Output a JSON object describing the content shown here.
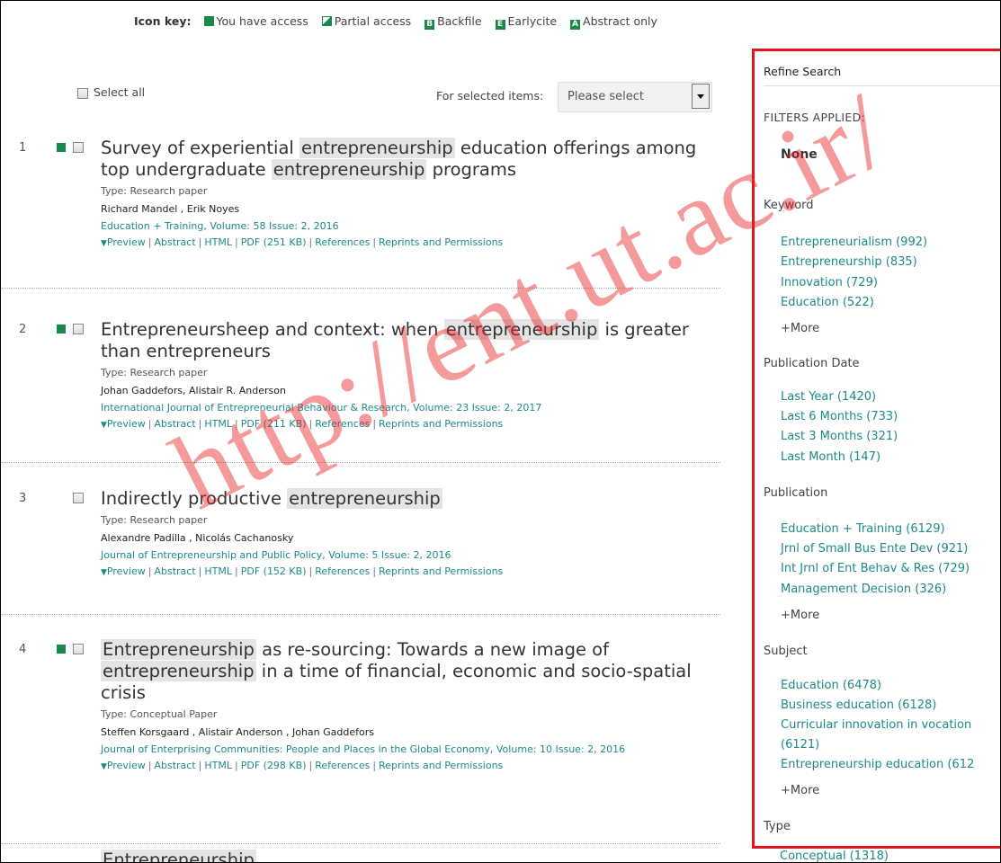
{
  "icon_key": {
    "label": "Icon key:",
    "items": [
      "You have access",
      "Partial access",
      "Backfile",
      "Earlycite",
      "Abstract only"
    ],
    "letters": [
      "B",
      "E",
      "A"
    ],
    "color": "#1a8a4a"
  },
  "toolbar": {
    "select_all": "Select all",
    "for_selected": "For selected items:",
    "dropdown_value": "Please select"
  },
  "results": [
    {
      "number": "1",
      "title_parts": [
        "Survey of experiential ",
        "entrepreneurship",
        " education offerings among top undergraduate ",
        "entrepreneurship",
        " programs"
      ],
      "type": "Type: Research paper",
      "authors": "Richard Mandel , Erik Noyes",
      "journal": "Education + Training, Volume: 58 Issue: 2, 2016",
      "links": [
        "Preview",
        "Abstract",
        "HTML",
        "PDF (251 KB)",
        "References",
        "Reprints and Permissions"
      ]
    },
    {
      "number": "2",
      "title_parts": [
        "Entrepreneursheep and context: when ",
        "entrepreneurship",
        " is greater than entrepreneurs"
      ],
      "type": "Type: Research paper",
      "authors": "Johan Gaddefors, Alistair R. Anderson",
      "journal": "International Journal of Entrepreneurial Behaviour & Research, Volume: 23 Issue: 2, 2017",
      "links": [
        "Preview",
        "Abstract",
        "HTML",
        "PDF (211 KB)",
        "References",
        "Reprints and Permissions"
      ]
    },
    {
      "number": "3",
      "title_parts": [
        "Indirectly productive ",
        "entrepreneurship",
        ""
      ],
      "type": "Type: Research paper",
      "authors": "Alexandre Padilla , Nicolás Cachanosky",
      "journal": "Journal of Entrepreneurship and Public Policy, Volume: 5 Issue: 2, 2016",
      "links": [
        "Preview",
        "Abstract",
        "HTML",
        "PDF (152 KB)",
        "References",
        "Reprints and Permissions"
      ]
    },
    {
      "number": "4",
      "title_parts": [
        "",
        "Entrepreneurship",
        " as re-sourcing: Towards a new image of ",
        "entrepreneurship",
        " in a time of financial, economic and socio-spatial crisis"
      ],
      "type": "Type: Conceptual Paper",
      "authors": "Steffen Korsgaard , Alistair Anderson , Johan Gaddefors",
      "journal": "Journal of Enterprising Communities: People and Places in the Global Economy, Volume: 10 Issue: 2, 2016",
      "links": [
        "Preview",
        "Abstract",
        "HTML",
        "PDF (298 KB)",
        "References",
        "Reprints and Permissions"
      ]
    }
  ],
  "partial_row": {
    "number": "5",
    "title_partial": "Entrepreneurship"
  },
  "refine": {
    "title": "Refine Search",
    "filters_applied": "FILTERS APPLIED:",
    "none": "None",
    "more_label": "+More",
    "sections": {
      "keyword": {
        "title": "Keyword",
        "items": [
          "Entrepreneurialism (992)",
          "Entrepreneurship (835)",
          "Innovation (729)",
          "Education (522)"
        ]
      },
      "publication_date": {
        "title": "Publication Date",
        "items": [
          "Last Year (1420)",
          "Last 6 Months (733)",
          "Last 3 Months (321)",
          "Last Month (147)"
        ]
      },
      "publication": {
        "title": "Publication",
        "items": [
          "Education + Training (6129)",
          "Jrnl of Small Bus Ente Dev (921)",
          "Int Jrnl of Ent Behav & Res (729)",
          "Management Decision (326)"
        ]
      },
      "subject": {
        "title": "Subject",
        "items": [
          "Education (6478)",
          "Business education (6128)",
          "Curricular innovation in vocation",
          "(6121)",
          "Entrepreneurship education (612"
        ]
      },
      "type": {
        "title": "Type",
        "items": [
          "Conceptual (1318)"
        ]
      }
    },
    "border_color": "#e5141e"
  },
  "watermark": "http://ent.ut.ac.ir/"
}
